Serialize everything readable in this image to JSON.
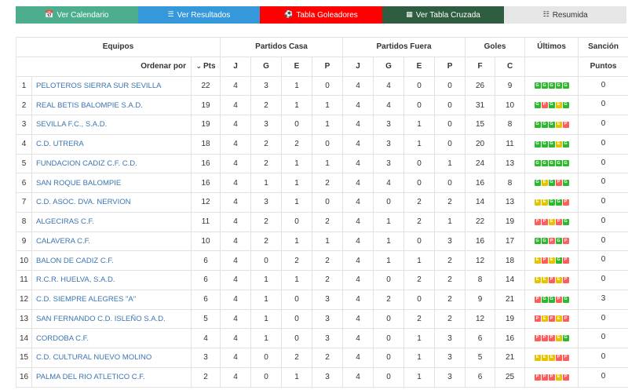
{
  "tabs": [
    {
      "label": "Ver Calendario",
      "icon": "calendar-icon"
    },
    {
      "label": "Ver Resultados",
      "icon": "list-icon"
    },
    {
      "label": "Tabla Goleadores",
      "icon": "soccer-ball-icon"
    },
    {
      "label": "Ver Tabla Cruzada",
      "icon": "grid-icon"
    },
    {
      "label": "Resumida",
      "icon": "list-alt-icon"
    }
  ],
  "colors": {
    "calendario": "#4cae8e",
    "resultados": "#3498db",
    "goleadores": "#ff0000",
    "cruzada": "#2f5d40",
    "resumida": "#e6e6e6",
    "team_link": "#3a75b0",
    "win": "#2eb82e",
    "draw": "#e6c300",
    "loss": "#ff5c5c"
  },
  "header": {
    "equipos": "Equipos",
    "partidos_casa": "Partidos Casa",
    "partidos_fuera": "Partidos Fuera",
    "goles": "Goles",
    "ultimos": "Últimos",
    "sancion": "Sanción",
    "ordenar_por": "Ordenar por",
    "pts": "Pts",
    "j": "J",
    "g": "G",
    "e": "E",
    "p": "P",
    "f": "F",
    "c": "C",
    "puntos": "Puntos"
  },
  "rows": [
    {
      "pos": "1",
      "team": "PELOTEROS SIERRA SUR SEVILLA",
      "pts": "22",
      "hj": "4",
      "hg": "3",
      "he": "1",
      "hp": "0",
      "aj": "4",
      "ag": "4",
      "ae": "0",
      "ap": "0",
      "f": "26",
      "c": "9",
      "last": [
        "G",
        "G",
        "G",
        "G",
        "G"
      ],
      "sancion": "0"
    },
    {
      "pos": "2",
      "team": "REAL BETIS BALOMPIE S.A.D.",
      "pts": "19",
      "hj": "4",
      "hg": "2",
      "he": "1",
      "hp": "1",
      "aj": "4",
      "ag": "4",
      "ae": "0",
      "ap": "0",
      "f": "31",
      "c": "10",
      "last": [
        "G",
        "P",
        "G",
        "E",
        "G"
      ],
      "sancion": "0"
    },
    {
      "pos": "3",
      "team": "SEVILLA F.C., S.A.D.",
      "pts": "19",
      "hj": "4",
      "hg": "3",
      "he": "0",
      "hp": "1",
      "aj": "4",
      "ag": "3",
      "ae": "1",
      "ap": "0",
      "f": "15",
      "c": "8",
      "last": [
        "G",
        "G",
        "G",
        "E",
        "P"
      ],
      "sancion": "0"
    },
    {
      "pos": "4",
      "team": "C.D. UTRERA",
      "pts": "18",
      "hj": "4",
      "hg": "2",
      "he": "2",
      "hp": "0",
      "aj": "4",
      "ag": "3",
      "ae": "1",
      "ap": "0",
      "f": "20",
      "c": "11",
      "last": [
        "G",
        "G",
        "G",
        "E",
        "G"
      ],
      "sancion": "0"
    },
    {
      "pos": "5",
      "team": "FUNDACION CADIZ C.F. C.D.",
      "pts": "16",
      "hj": "4",
      "hg": "2",
      "he": "1",
      "hp": "1",
      "aj": "4",
      "ag": "3",
      "ae": "0",
      "ap": "1",
      "f": "24",
      "c": "13",
      "last": [
        "G",
        "G",
        "G",
        "G",
        "G"
      ],
      "sancion": "0"
    },
    {
      "pos": "6",
      "team": "SAN ROQUE BALOMPIE",
      "pts": "16",
      "hj": "4",
      "hg": "1",
      "he": "1",
      "hp": "2",
      "aj": "4",
      "ag": "4",
      "ae": "0",
      "ap": "0",
      "f": "16",
      "c": "8",
      "last": [
        "G",
        "E",
        "G",
        "P",
        "G"
      ],
      "sancion": "0"
    },
    {
      "pos": "7",
      "team": "C.D. ASOC. DVA. NERVION",
      "pts": "12",
      "hj": "4",
      "hg": "3",
      "he": "1",
      "hp": "0",
      "aj": "4",
      "ag": "0",
      "ae": "2",
      "ap": "2",
      "f": "14",
      "c": "13",
      "last": [
        "E",
        "E",
        "G",
        "G",
        "P"
      ],
      "sancion": "0"
    },
    {
      "pos": "8",
      "team": "ALGECIRAS C.F.",
      "pts": "11",
      "hj": "4",
      "hg": "2",
      "he": "0",
      "hp": "2",
      "aj": "4",
      "ag": "1",
      "ae": "2",
      "ap": "1",
      "f": "22",
      "c": "19",
      "last": [
        "P",
        "P",
        "E",
        "P",
        "G"
      ],
      "sancion": "0"
    },
    {
      "pos": "9",
      "team": "CALAVERA C.F.",
      "pts": "10",
      "hj": "4",
      "hg": "2",
      "he": "1",
      "hp": "1",
      "aj": "4",
      "ag": "1",
      "ae": "0",
      "ap": "3",
      "f": "16",
      "c": "17",
      "last": [
        "G",
        "G",
        "P",
        "G",
        "P"
      ],
      "sancion": "0"
    },
    {
      "pos": "10",
      "team": "BALON DE CADIZ C.F.",
      "pts": "6",
      "hj": "4",
      "hg": "0",
      "he": "2",
      "hp": "2",
      "aj": "4",
      "ag": "1",
      "ae": "1",
      "ap": "2",
      "f": "12",
      "c": "18",
      "last": [
        "E",
        "P",
        "E",
        "G",
        "P"
      ],
      "sancion": "0"
    },
    {
      "pos": "11",
      "team": "R.C.R. HUELVA, S.A.D.",
      "pts": "6",
      "hj": "4",
      "hg": "1",
      "he": "1",
      "hp": "2",
      "aj": "4",
      "ag": "0",
      "ae": "2",
      "ap": "2",
      "f": "8",
      "c": "14",
      "last": [
        "E",
        "E",
        "P",
        "E",
        "P"
      ],
      "sancion": "0"
    },
    {
      "pos": "12",
      "team": "C.D. SIEMPRE ALEGRES \"A\"",
      "pts": "6",
      "hj": "4",
      "hg": "1",
      "he": "0",
      "hp": "3",
      "aj": "4",
      "ag": "2",
      "ae": "0",
      "ap": "2",
      "f": "9",
      "c": "21",
      "last": [
        "P",
        "G",
        "G",
        "P",
        "G"
      ],
      "sancion": "3"
    },
    {
      "pos": "13",
      "team": "SAN FERNANDO C.D. ISLEÑO S.A.D.",
      "pts": "5",
      "hj": "4",
      "hg": "1",
      "he": "0",
      "hp": "3",
      "aj": "4",
      "ag": "0",
      "ae": "2",
      "ap": "2",
      "f": "12",
      "c": "19",
      "last": [
        "P",
        "E",
        "P",
        "E",
        "P"
      ],
      "sancion": "0"
    },
    {
      "pos": "14",
      "team": "CORDOBA C.F.",
      "pts": "4",
      "hj": "4",
      "hg": "1",
      "he": "0",
      "hp": "3",
      "aj": "4",
      "ag": "0",
      "ae": "1",
      "ap": "3",
      "f": "6",
      "c": "16",
      "last": [
        "P",
        "P",
        "P",
        "E",
        "G"
      ],
      "sancion": "0"
    },
    {
      "pos": "15",
      "team": "C.D. CULTURAL NUEVO MOLINO",
      "pts": "3",
      "hj": "4",
      "hg": "0",
      "he": "2",
      "hp": "2",
      "aj": "4",
      "ag": "0",
      "ae": "1",
      "ap": "3",
      "f": "5",
      "c": "21",
      "last": [
        "E",
        "E",
        "E",
        "P",
        "P"
      ],
      "sancion": "0"
    },
    {
      "pos": "16",
      "team": "PALMA DEL RIO ATLETICO C.F.",
      "pts": "2",
      "hj": "4",
      "hg": "0",
      "he": "1",
      "hp": "3",
      "aj": "4",
      "ag": "0",
      "ae": "1",
      "ap": "3",
      "f": "6",
      "c": "25",
      "last": [
        "P",
        "P",
        "P",
        "E",
        "P"
      ],
      "sancion": "0"
    }
  ]
}
